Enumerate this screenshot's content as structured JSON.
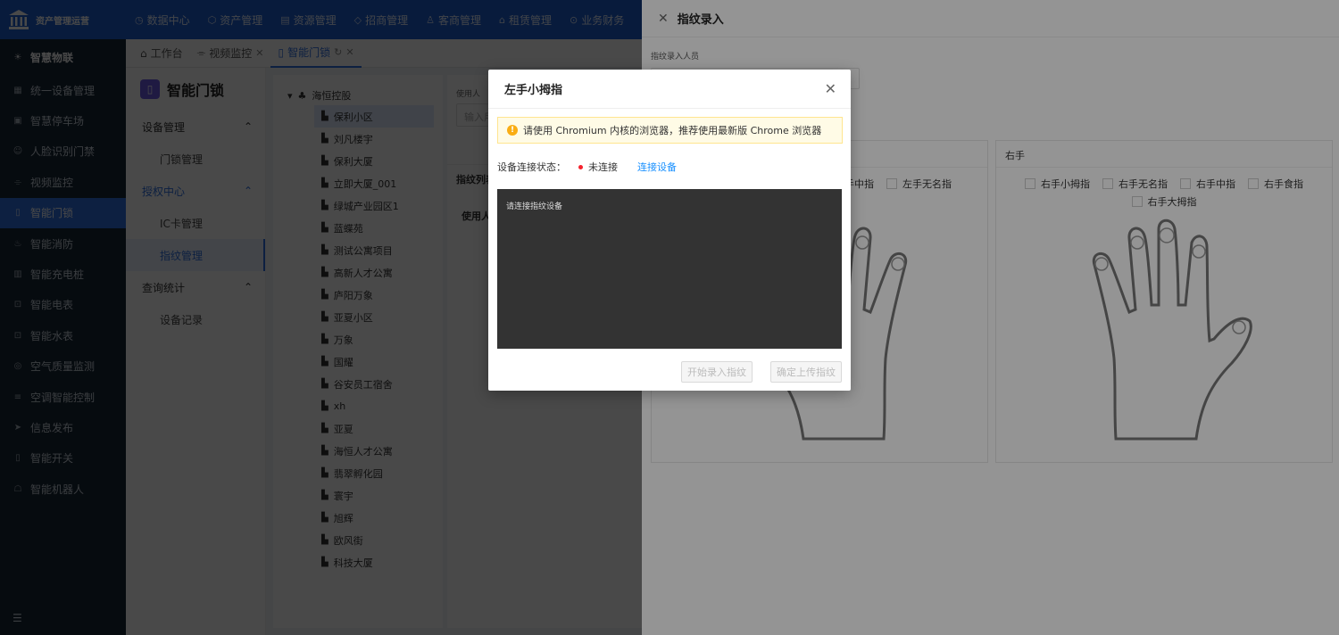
{
  "brand": {
    "title": "资产管理运营"
  },
  "top_menu": [
    {
      "icon": "dashboard-icon",
      "glyph": "◷",
      "label": "数据中心"
    },
    {
      "icon": "cube-icon",
      "glyph": "⬡",
      "label": "资产管理"
    },
    {
      "icon": "document-icon",
      "glyph": "▤",
      "label": "资源管理"
    },
    {
      "icon": "tag-icon",
      "glyph": "◇",
      "label": "招商管理"
    },
    {
      "icon": "people-icon",
      "glyph": "♙",
      "label": "客商管理"
    },
    {
      "icon": "home-icon",
      "glyph": "⌂",
      "label": "租赁管理"
    },
    {
      "icon": "finance-icon",
      "glyph": "⊙",
      "label": "业务财务"
    }
  ],
  "sidebar": {
    "group": "智慧物联",
    "items": [
      {
        "label": "统一设备管理",
        "icon": "device-icon",
        "glyph": "▦"
      },
      {
        "label": "智慧停车场",
        "icon": "parking-icon",
        "glyph": "▣"
      },
      {
        "label": "人脸识别门禁",
        "icon": "face-icon",
        "glyph": "☺"
      },
      {
        "label": "视频监控",
        "icon": "camera-icon",
        "glyph": "⌯"
      },
      {
        "label": "智能门锁",
        "icon": "lock-icon",
        "glyph": "▯"
      },
      {
        "label": "智能消防",
        "icon": "fire-icon",
        "glyph": "♨"
      },
      {
        "label": "智能充电桩",
        "icon": "charge-icon",
        "glyph": "▥"
      },
      {
        "label": "智能电表",
        "icon": "meter-icon",
        "glyph": "⊡"
      },
      {
        "label": "智能水表",
        "icon": "water-icon",
        "glyph": "⊡"
      },
      {
        "label": "空气质量监测",
        "icon": "air-icon",
        "glyph": "◎"
      },
      {
        "label": "空调智能控制",
        "icon": "ac-icon",
        "glyph": "≡"
      },
      {
        "label": "信息发布",
        "icon": "send-icon",
        "glyph": "➤"
      },
      {
        "label": "智能开关",
        "icon": "switch-icon",
        "glyph": "▯"
      },
      {
        "label": "智能机器人",
        "icon": "robot-icon",
        "glyph": "☖"
      }
    ],
    "active_index": 4
  },
  "tabs": [
    {
      "label": "工作台",
      "icon": "home-icon"
    },
    {
      "label": "视频监控",
      "icon": "camera-icon"
    },
    {
      "label": "智能门锁",
      "icon": "lock-icon"
    }
  ],
  "sub_sidebar": {
    "title": "智能门锁",
    "groups": [
      {
        "label": "设备管理",
        "items": [
          "门锁管理"
        ]
      },
      {
        "label": "授权中心",
        "items": [
          "IC卡管理",
          "指纹管理"
        ]
      },
      {
        "label": "查询统计",
        "items": [
          "设备记录"
        ]
      }
    ]
  },
  "tree": {
    "root": "海恒控股",
    "nodes": [
      "保利小区",
      "刘凡楼宇",
      "保利大厦",
      "立即大厦_001",
      "绿城产业园区1",
      "蓝蝶苑",
      "测试公寓项目",
      "高新人才公寓",
      "庐阳万象",
      "亚夏小区",
      "万象",
      "国耀",
      "谷安员工宿舍",
      "xh",
      "亚夏",
      "海恒人才公寓",
      "翡翠孵化园",
      "寰宇",
      "旭辉",
      "欧风街",
      "科技大厦"
    ],
    "selected": 0
  },
  "mid": {
    "label": "使用人",
    "placeholder": "输入用",
    "list_title": "指纹列表",
    "column": "使用人"
  },
  "drawer": {
    "title": "指纹录入",
    "label": "指纹录入人员",
    "left_hand": {
      "fingers_visible": [
        "手中指",
        "左手无名指"
      ]
    },
    "right_hand": {
      "title": "右手",
      "fingers": [
        "右手小拇指",
        "右手无名指",
        "右手中指",
        "右手食指",
        "右手大拇指"
      ]
    }
  },
  "dialog": {
    "title": "左手小拇指",
    "alert": "请使用 Chromium 内核的浏览器，推荐使用最新版 Chrome 浏览器",
    "status_label": "设备连接状态：",
    "status_value": "未连接",
    "connect_link": "连接设备",
    "console_text": "请连接指纹设备",
    "btn_start": "开始录入指纹",
    "btn_upload": "确定上传指纹"
  },
  "colors": {
    "nav_blue": "#1f5fd1",
    "sidebar_bg": "#192635",
    "active": "#2e6fe0",
    "link": "#1890ff",
    "status_red": "#f5222d",
    "alert_bg": "#fffbe6"
  }
}
